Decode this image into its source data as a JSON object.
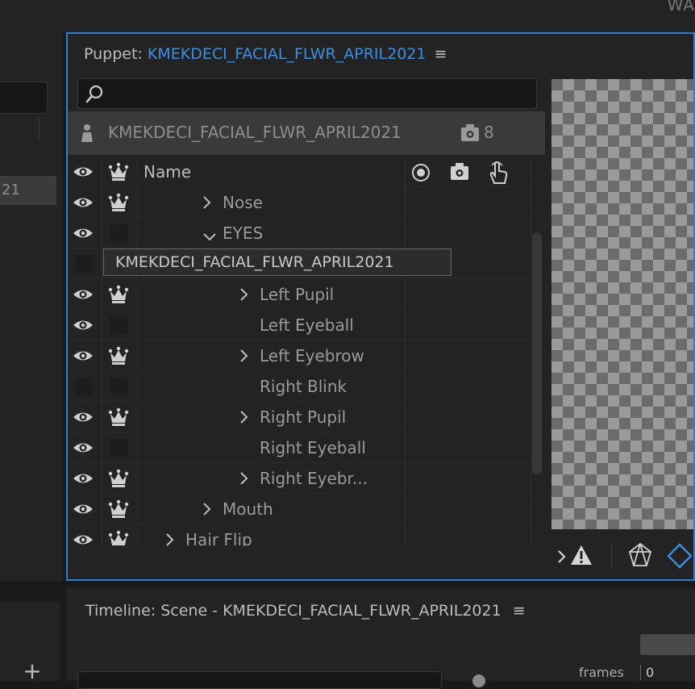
{
  "topbar": {
    "text": "WA"
  },
  "left_panel": {
    "selected_item": "21",
    "add_label": "+"
  },
  "puppet_panel": {
    "title_prefix": "Puppet: ",
    "title_name": "KMEKDECI_FACIAL_FLWR_APRIL2021",
    "menu_icon": "≡",
    "search_placeholder": "",
    "puppet_row": {
      "name": "KMEKDECI_FACIAL_FLWR_APRIL2021",
      "count": "8"
    },
    "header": {
      "name_label": "Name"
    },
    "rows": [
      {
        "label": "Nose",
        "indent": 1,
        "chevron": "›",
        "eye": true,
        "crown": true
      },
      {
        "label": "EYES",
        "indent": 1,
        "chevron": "⌄",
        "eye": true,
        "crown": false
      },
      {
        "label": "",
        "indent": 2,
        "chevron": "",
        "eye": false,
        "crown": false
      },
      {
        "label": "Left Pupil",
        "indent": 2,
        "chevron": "›",
        "eye": true,
        "crown": true
      },
      {
        "label": "Left Eyeball",
        "indent": 2,
        "chevron": "",
        "eye": true,
        "crown": false
      },
      {
        "label": "Left Eyebrow",
        "indent": 2,
        "chevron": "›",
        "eye": true,
        "crown": true
      },
      {
        "label": "Right Blink",
        "indent": 2,
        "chevron": "",
        "eye": false,
        "crown": false
      },
      {
        "label": "Right Pupil",
        "indent": 2,
        "chevron": "›",
        "eye": true,
        "crown": true
      },
      {
        "label": "Right Eyeball",
        "indent": 2,
        "chevron": "",
        "eye": true,
        "crown": false
      },
      {
        "label": "Right Eyebr...",
        "indent": 2,
        "chevron": "›",
        "eye": true,
        "crown": true
      },
      {
        "label": "Mouth",
        "indent": 1,
        "chevron": "›",
        "eye": true,
        "crown": true
      },
      {
        "label": "Hair Flip",
        "indent": 0,
        "chevron": "›",
        "eye": true,
        "crown": true
      }
    ],
    "tooltip": "KMEKDECI_FACIAL_FLWR_APRIL2021"
  },
  "timeline": {
    "title": "Timeline: Scene - KMEKDECI_FACIAL_FLWR_APRIL2021",
    "menu_icon": "≡",
    "frames_label": "frames",
    "frame_value": "0"
  },
  "colors": {
    "accent": "#3b8ee0",
    "panel": "#232323",
    "background": "#1a1a1a"
  }
}
